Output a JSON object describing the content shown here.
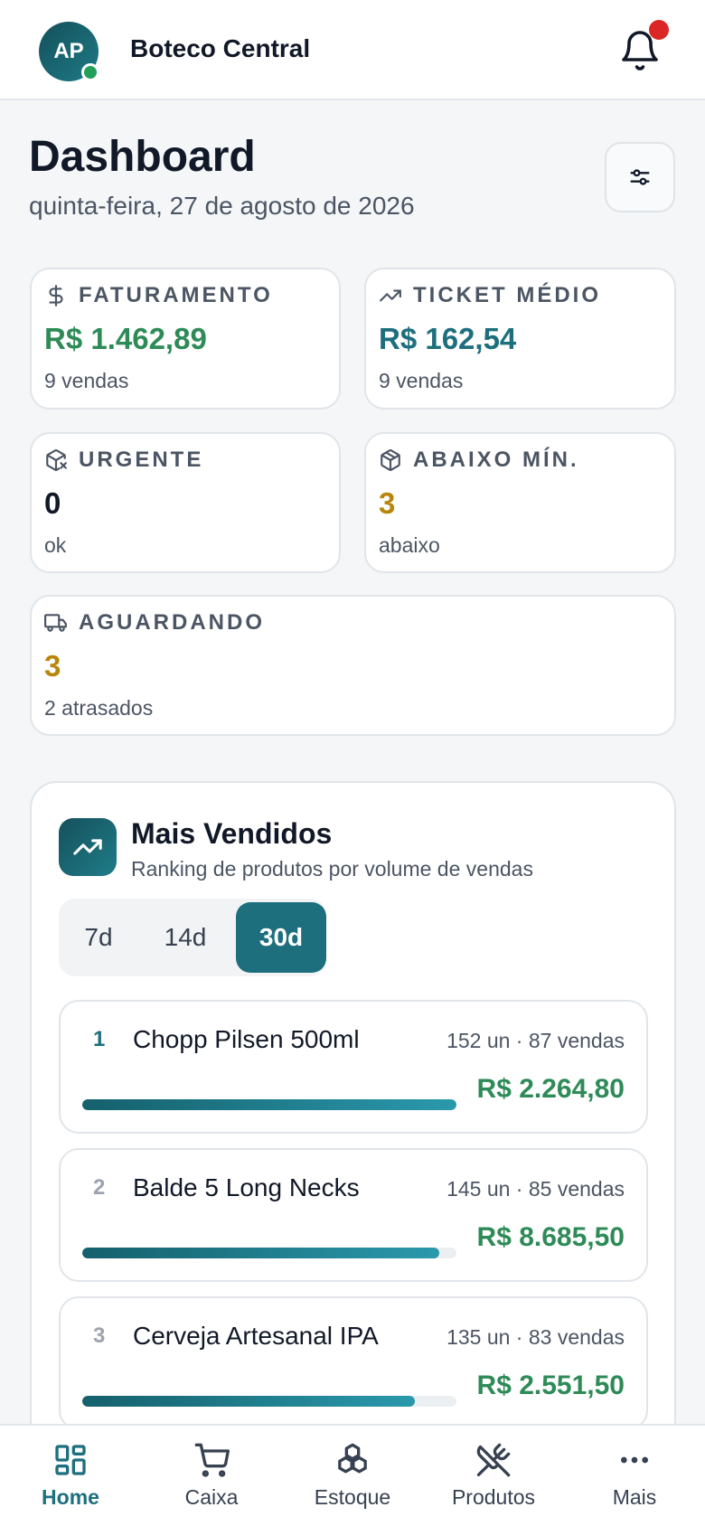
{
  "header": {
    "avatar_initials": "AP",
    "business_name": "Boteco Central",
    "notification_dot_color": "#dc2626"
  },
  "page": {
    "title": "Dashboard",
    "date": "quinta-feira, 27 de agosto de 2026"
  },
  "kpis": {
    "faturamento": {
      "label": "FATURAMENTO",
      "value": "R$ 1.462,89",
      "sub": "9 vendas",
      "color": "#2e8b57",
      "icon": "dollar-icon"
    },
    "ticket": {
      "label": "TICKET MÉDIO",
      "value": "R$ 162,54",
      "sub": "9 vendas",
      "color": "#1d6f7d",
      "icon": "trending-up-icon"
    },
    "urgente": {
      "label": "URGENTE",
      "value": "0",
      "sub": "ok",
      "color": "#111827",
      "icon": "package-x-icon"
    },
    "abaixo": {
      "label": "ABAIXO MÍN.",
      "value": "3",
      "sub": "abaixo",
      "color": "#b8860b",
      "icon": "package-icon"
    },
    "aguardando": {
      "label": "AGUARDANDO",
      "value": "3",
      "sub": "2 atrasados",
      "color": "#b8860b",
      "icon": "truck-icon"
    }
  },
  "top_sellers": {
    "title": "Mais Vendidos",
    "subtitle": "Ranking de produtos por volume de vendas",
    "periods": [
      "7d",
      "14d",
      "30d"
    ],
    "selected_period": "30d",
    "items": [
      {
        "rank": "1",
        "name": "Chopp Pilsen 500ml",
        "meta": "152 un · 87 vendas",
        "revenue": "R$ 2.264,80",
        "share": 1.0,
        "rank_color": "#1d6f7d"
      },
      {
        "rank": "2",
        "name": "Balde 5 Long Necks",
        "meta": "145 un · 85 vendas",
        "revenue": "R$ 8.685,50",
        "share": 0.954,
        "rank_color": "#9ca3af"
      },
      {
        "rank": "3",
        "name": "Cerveja Artesanal IPA",
        "meta": "135 un · 83 vendas",
        "revenue": "R$ 2.551,50",
        "share": 0.888,
        "rank_color": "#9ca3af"
      }
    ]
  },
  "nav": {
    "items": [
      {
        "label": "Home",
        "icon": "grid-icon",
        "active": true
      },
      {
        "label": "Caixa",
        "icon": "cart-icon",
        "active": false
      },
      {
        "label": "Estoque",
        "icon": "boxes-icon",
        "active": false
      },
      {
        "label": "Produtos",
        "icon": "utensils-icon",
        "active": false
      },
      {
        "label": "Mais",
        "icon": "more-icon",
        "active": false
      }
    ]
  }
}
